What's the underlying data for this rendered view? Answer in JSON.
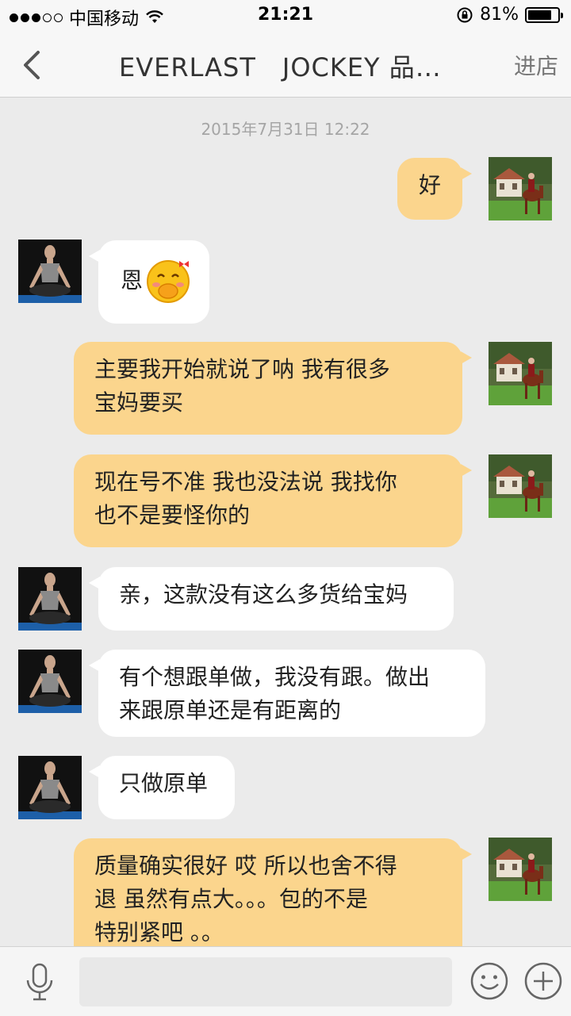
{
  "status_bar": {
    "carrier": "中国移动",
    "time": "21:21",
    "battery": "81%",
    "battery_level": 0.81
  },
  "nav": {
    "title": "EVERLAST　JOCKEY 品…",
    "right_action": "进店"
  },
  "chat": {
    "timestamp": "2015年7月31日 12:22",
    "messages": [
      {
        "side": "out",
        "text": "好"
      },
      {
        "side": "in",
        "text": "恩",
        "emoji": "shy-covering-mouth-emoji"
      },
      {
        "side": "out",
        "line1": "主要我开始就说了呐  我有很多",
        "line2": "宝妈要买"
      },
      {
        "side": "out",
        "line1": "现在号不准 我也没法说  我找你",
        "line2": "也不是要怪你的"
      },
      {
        "side": "in",
        "text": "亲，这款没有这么多货给宝妈"
      },
      {
        "side": "in",
        "line1": "有个想跟单做，我没有跟。做出",
        "line2": "来跟原单还是有距离的"
      },
      {
        "side": "in",
        "text": "只做原单"
      },
      {
        "side": "out",
        "line1": "质量确实很好  哎 所以也舍不得",
        "line2": "退  虽然有点大。。。包的不是",
        "line3": "特别紧吧 。。"
      }
    ]
  },
  "colors": {
    "outgoing_bubble": "#fbd58d",
    "incoming_bubble": "#ffffff",
    "background": "#ebebeb"
  }
}
